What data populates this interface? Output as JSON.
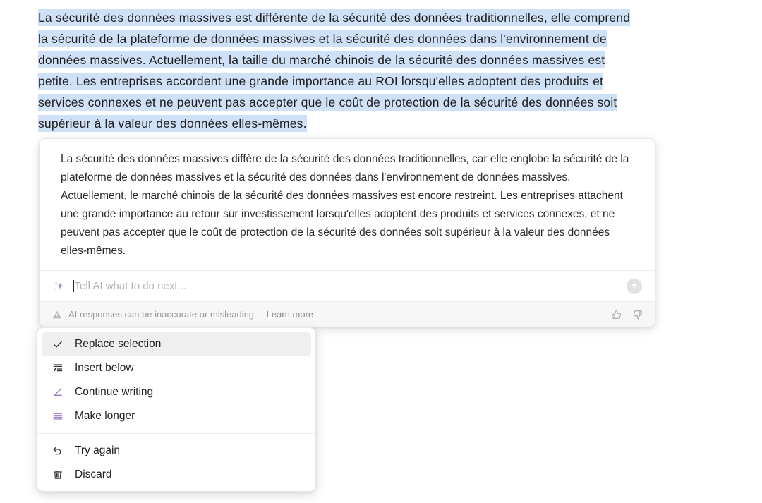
{
  "selection": {
    "highlight_color": "#cfe1f7",
    "text": "La sécurité des données massives est différente de la sécurité des données traditionnelles, elle comprend la sécurité de la plateforme de données massives et la sécurité des données dans l'environnement de données massives. Actuellement, la taille du marché chinois de la sécurité des données massives est petite. Les entreprises accordent une grande importance au ROI lorsqu'elles adoptent des produits et services connexes et ne peuvent pas accepter que le coût de protection de la sécurité des données soit supérieur à la valeur des données elles-mêmes."
  },
  "ai_card": {
    "response_text": "La sécurité des données massives diffère de la sécurité des données traditionnelles, car elle englobe la sécurité de la plateforme de données massives et la sécurité des données dans l'environnement de données massives. Actuellement, le marché chinois de la sécurité des données massives est encore restreint. Les entreprises attachent une grande importance au retour sur investissement lorsqu'elles adoptent des produits et services connexes, et ne peuvent pas accepter que le coût de protection de la sécurité des données soit supérieur à la valeur des données elles-mêmes.",
    "prompt": {
      "icon": "sparkle-icon",
      "placeholder": "Tell AI what to do next...",
      "value": "",
      "accent_color": "#a78bc8",
      "submit_icon": "arrow-up-icon"
    },
    "footer": {
      "icon": "warning-triangle-icon",
      "disclaimer": "AI responses can be inaccurate or misleading.",
      "learn_more": "Learn more",
      "thumbs_up_icon": "thumbs-up-icon",
      "thumbs_down_icon": "thumbs-down-icon"
    }
  },
  "action_menu": {
    "items": [
      {
        "label": "Replace selection",
        "icon": "check-icon",
        "active": true,
        "icon_color": "#333333"
      },
      {
        "label": "Insert below",
        "icon": "insert-below-icon",
        "active": false,
        "icon_color": "#333333"
      },
      {
        "label": "Continue writing",
        "icon": "pencil-icon",
        "active": false,
        "icon_color": "#9b7cc4"
      },
      {
        "label": "Make longer",
        "icon": "make-longer-icon",
        "active": false,
        "icon_color": "#9b7cc4"
      }
    ],
    "secondary_items": [
      {
        "label": "Try again",
        "icon": "undo-arrow-icon",
        "active": false,
        "icon_color": "#333333"
      },
      {
        "label": "Discard",
        "icon": "trash-icon",
        "active": false,
        "icon_color": "#333333"
      }
    ]
  }
}
